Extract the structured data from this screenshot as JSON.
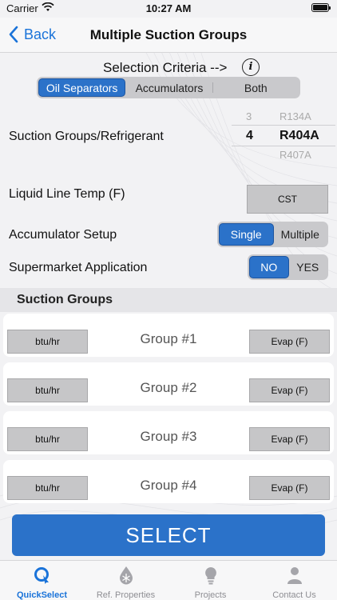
{
  "status_bar": {
    "carrier": "Carrier",
    "time": "10:27 AM"
  },
  "nav": {
    "back_label": "Back",
    "title": "Multiple Suction Groups"
  },
  "criteria": {
    "label": "Selection Criteria -->",
    "info_glyph": "i",
    "segments": [
      "Oil Separators",
      "Accumulators",
      "Both"
    ],
    "selected_segment": "Oil Separators"
  },
  "suction_groups_refrigerant": {
    "label": "Suction Groups/Refrigerant",
    "picker_rows": [
      {
        "number": "3",
        "refrigerant": "R134A"
      },
      {
        "number": "4",
        "refrigerant": "R404A"
      },
      {
        "number": "",
        "refrigerant": "R407A"
      }
    ],
    "selected_number": "4",
    "selected_refrigerant": "R404A"
  },
  "liquid_line": {
    "label": "Liquid Line Temp (F)",
    "button_label": "CST"
  },
  "accumulator_setup": {
    "label": "Accumulator Setup",
    "options": [
      "Single",
      "Multiple"
    ],
    "selected": "Single"
  },
  "supermarket": {
    "label": "Supermarket Application",
    "options": [
      "NO",
      "YES"
    ],
    "selected": "NO"
  },
  "suction_groups": {
    "header": "Suction Groups",
    "groups": [
      {
        "name": "Group #1",
        "btu_label": "btu/hr",
        "evap_label": "Evap (F)"
      },
      {
        "name": "Group #2",
        "btu_label": "btu/hr",
        "evap_label": "Evap (F)"
      },
      {
        "name": "Group #3",
        "btu_label": "btu/hr",
        "evap_label": "Evap (F)"
      },
      {
        "name": "Group #4",
        "btu_label": "btu/hr",
        "evap_label": "Evap (F)"
      }
    ]
  },
  "select_button": "SELECT",
  "tabs": [
    {
      "label": "QuickSelect",
      "icon": "quickselect-icon",
      "active": true
    },
    {
      "label": "Ref. Properties",
      "icon": "snowflake-drop-icon",
      "active": false
    },
    {
      "label": "Projects",
      "icon": "lightbulb-icon",
      "active": false
    },
    {
      "label": "Contact Us",
      "icon": "person-icon",
      "active": false
    }
  ],
  "colors": {
    "accent": "#2b72c9",
    "link": "#1a73d9",
    "button_gray": "#c6c6c8",
    "background": "#f2f2f4"
  }
}
